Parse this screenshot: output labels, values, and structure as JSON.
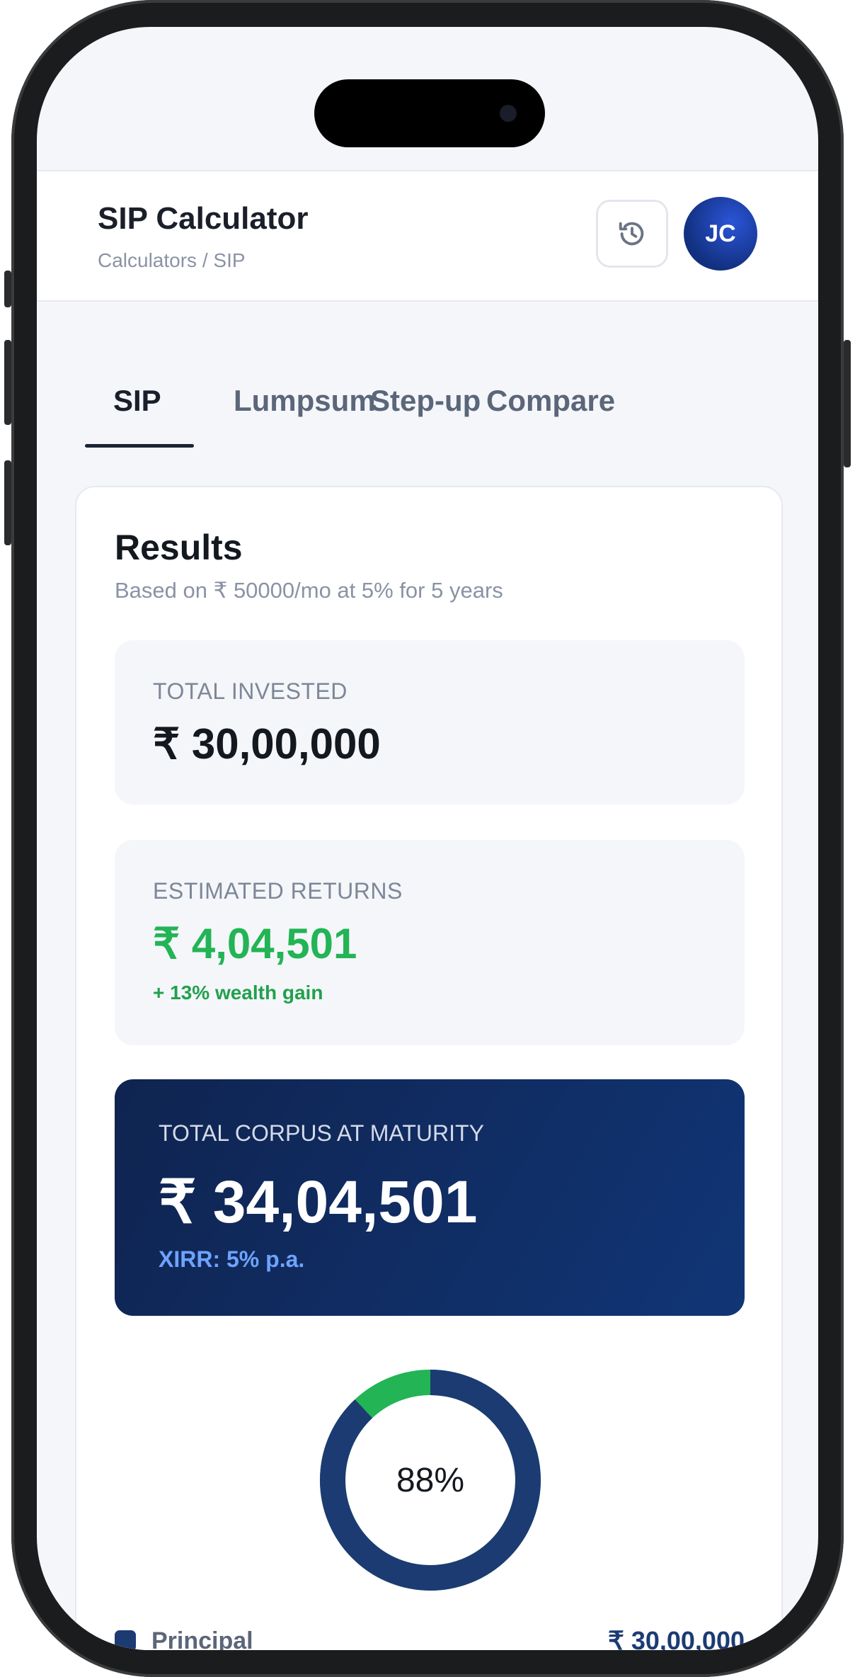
{
  "header": {
    "title": "SIP Calculator",
    "breadcrumb": "Calculators  / SIP",
    "history_icon": "history-icon",
    "avatar_initials": "JC"
  },
  "tabs": [
    {
      "label": "SIP",
      "active": true
    },
    {
      "label": "Lumpsum",
      "active": false
    },
    {
      "label": "Step-up",
      "active": false
    },
    {
      "label": "Compare",
      "active": false
    }
  ],
  "results": {
    "title": "Results",
    "subtitle": "Based on ₹ 50000/mo at 5% for 5 years",
    "total_invested": {
      "label": "TOTAL INVESTED",
      "value": "₹ 30,00,000"
    },
    "estimated_returns": {
      "label": "ESTIMATED RETURNS",
      "value": "₹ 4,04,501",
      "note": "+ 13% wealth gain"
    },
    "maturity": {
      "label": "TOTAL CORPUS AT MATURITY",
      "value": "₹ 34,04,501",
      "note": "XIRR: 5% p.a."
    },
    "donut": {
      "center_label": "88%",
      "principal_fraction": 0.88,
      "principal_color": "#1c3b73",
      "returns_color": "#22b455"
    },
    "legend": [
      {
        "label": "Principal",
        "value": "₹ 30,00,000",
        "color": "#1c3b73"
      }
    ]
  }
}
